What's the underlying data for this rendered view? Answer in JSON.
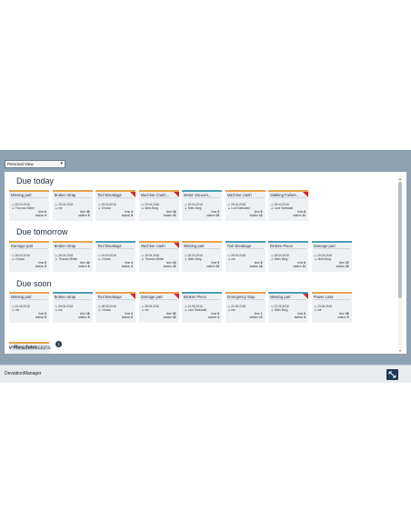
{
  "view_select": {
    "value": "Personal View"
  },
  "sections": {
    "today": "Due today",
    "tomorrow": "Due tomorrow",
    "soon": "Due soon"
  },
  "resubmissions": {
    "label": "Resubmissions",
    "count": "1"
  },
  "footer": {
    "app_name": "DeviationManager"
  },
  "field_labels": {
    "time": "time",
    "station": "station"
  },
  "cards": {
    "today": [
      {
        "title": "Missing part",
        "date": "25.04.2016",
        "user": "Thomas Müller",
        "time": "6",
        "station": "5",
        "color": "#e8a24a",
        "flag": false
      },
      {
        "title": "Broken strap",
        "date": "25.04.2016",
        "user": "me",
        "time": "40",
        "station": "5",
        "color": "#e8a24a",
        "flag": false
      },
      {
        "title": "Tool Breakage",
        "date": "25.04.2016",
        "user": "Chuwa",
        "time": "3",
        "station": "8",
        "color": "#e8a24a",
        "flag": true
      },
      {
        "title": "Machine Crash...",
        "date": "25.04.2016",
        "user": "Niels Borg",
        "time": "16",
        "station": "22",
        "color": "#e8a24a",
        "flag": true
      },
      {
        "title": "Motor Vacuum...",
        "date": "25.04.2016",
        "user": "Niels Borg",
        "time": "5",
        "station": "15",
        "color": "#4a9fb5",
        "flag": false
      },
      {
        "title": "Machine crash",
        "date": "25.04.2016",
        "user": "Lord Sarkwald",
        "time": "8",
        "station": "10",
        "color": "#e8a24a",
        "flag": false
      },
      {
        "title": "Stalking Failure...",
        "date": "25.04.2016",
        "user": "Lord Sarkwald",
        "time": "6",
        "station": "12",
        "color": "#e8a24a",
        "flag": true
      }
    ],
    "tomorrow": [
      {
        "title": "Damage part",
        "date": "26.04.2016",
        "user": "Chuwa",
        "time": "5",
        "station": "5",
        "color": "#e8a24a",
        "flag": false
      },
      {
        "title": "Broken strap",
        "date": "26.04.2016",
        "user": "Thomas Müller",
        "time": "44",
        "station": "8",
        "color": "#e8a24a",
        "flag": false
      },
      {
        "title": "Tool Breakage",
        "date": "26.04.2016",
        "user": "Chuwa",
        "time": "4",
        "station": "4",
        "color": "#4a9fb5",
        "flag": false
      },
      {
        "title": "Machine crash",
        "date": "26.04.2016",
        "user": "Thomas Müller",
        "time": "24",
        "station": "22",
        "color": "#e8a24a",
        "flag": true
      },
      {
        "title": "Missing part",
        "date": "26.04.2016",
        "user": "Niels Borg",
        "time": "5",
        "station": "15",
        "color": "#e8a24a",
        "flag": false
      },
      {
        "title": "Tool Breakage",
        "date": "26.04.2016",
        "user": "me",
        "time": "8",
        "station": "18",
        "color": "#4a9fb5",
        "flag": false
      },
      {
        "title": "Broken Piece",
        "date": "26.04.2016",
        "user": "Niels Borg",
        "time": "6",
        "station": "11",
        "color": "#4a9fb5",
        "flag": false
      },
      {
        "title": "Damage part",
        "date": "26.04.2016",
        "user": "Niels Borg",
        "time": "20",
        "station": "26",
        "color": "#4a9fb5",
        "flag": false
      }
    ],
    "soon": [
      {
        "title": "Missing part",
        "date": "01.05.2016",
        "user": "me",
        "time": "6",
        "station": "8",
        "color": "#e8a24a",
        "flag": false
      },
      {
        "title": "Broken strap",
        "date": "05.05.2016",
        "user": "me",
        "time": "18",
        "station": "5",
        "color": "#4a9fb5",
        "flag": false
      },
      {
        "title": "Tool Breakage",
        "date": "08.05.2016",
        "user": "Chuwa",
        "time": "4",
        "station": "9",
        "color": "#e8a24a",
        "flag": true
      },
      {
        "title": "Damage part",
        "date": "08.05.2016",
        "user": "me",
        "time": "30",
        "station": "32",
        "color": "#e8a24a",
        "flag": true
      },
      {
        "title": "Broken Piece",
        "date": "21.05.2016",
        "user": "Lord Sarkwald",
        "time": "6",
        "station": "4",
        "color": "#4a9fb5",
        "flag": false
      },
      {
        "title": "Emergency Stop",
        "date": "21.05.2016",
        "user": "me",
        "time": "1",
        "station": "12",
        "color": "#e8a24a",
        "flag": false
      },
      {
        "title": "Missing part",
        "date": "22.05.2016",
        "user": "Niels Borg",
        "time": "6",
        "station": "5",
        "color": "#4a9fb5",
        "flag": true
      },
      {
        "title": "Power Loss",
        "date": "23.06.2016",
        "user": "me",
        "time": "38",
        "station": "9",
        "color": "#e8a24a",
        "flag": false
      }
    ],
    "soon_extra": [
      {
        "title": "Stalking Failure",
        "color": "#e8a24a"
      }
    ]
  }
}
